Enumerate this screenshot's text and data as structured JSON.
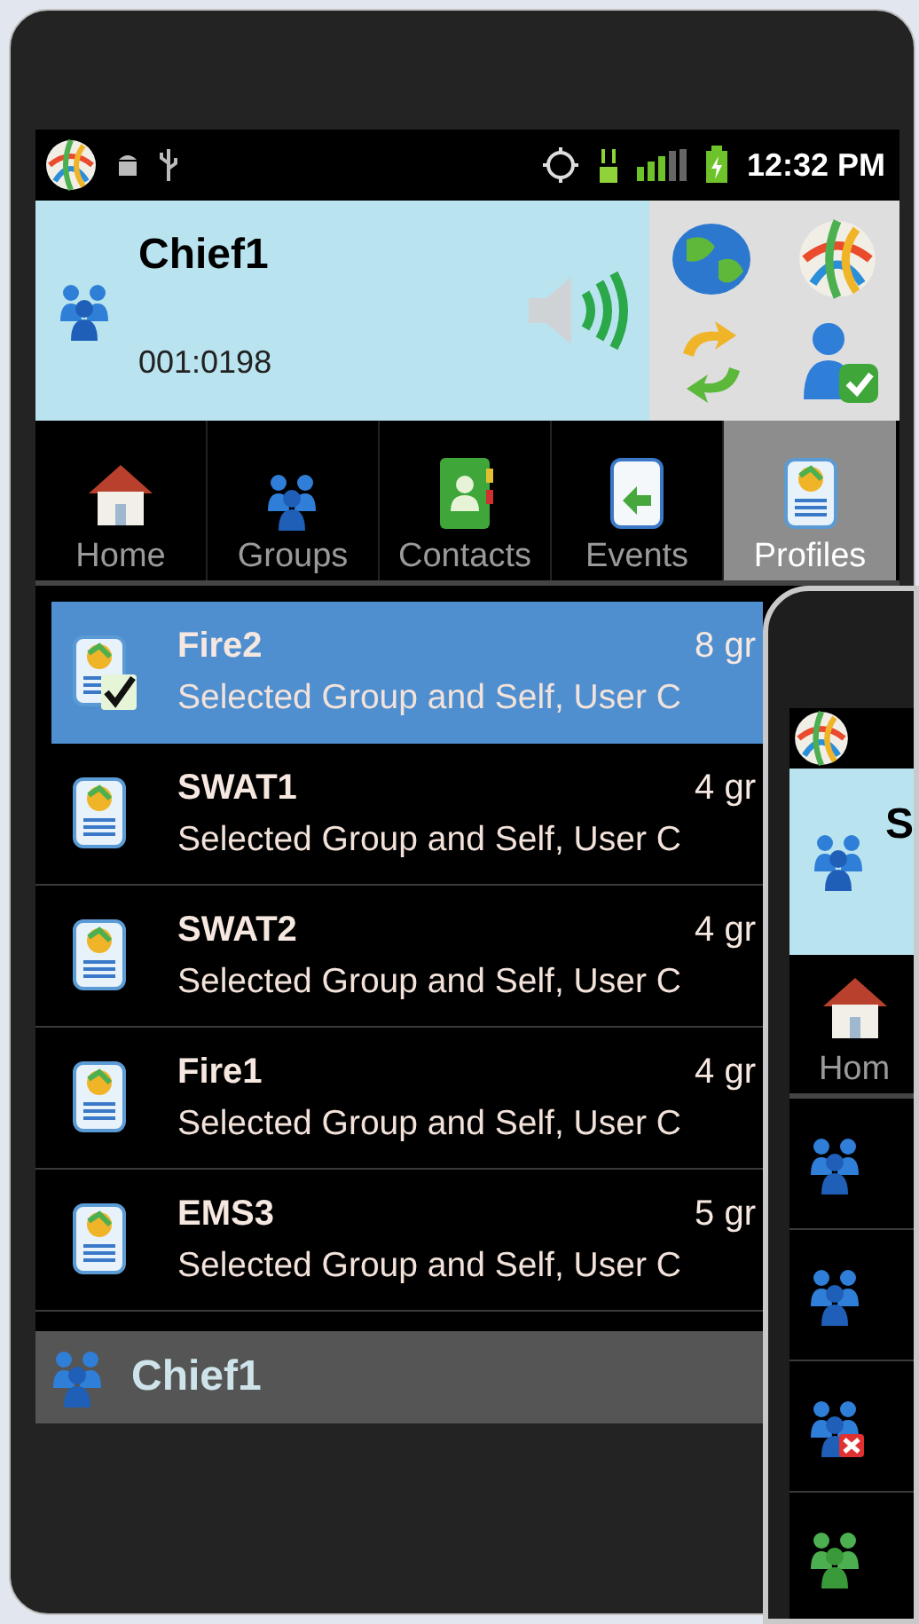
{
  "status_bar": {
    "time": "12:32 PM"
  },
  "header": {
    "title": "Chief1",
    "number": "001:0198"
  },
  "tabs": [
    {
      "label": "Home",
      "selected": false
    },
    {
      "label": "Groups",
      "selected": false
    },
    {
      "label": "Contacts",
      "selected": false
    },
    {
      "label": "Events",
      "selected": false
    },
    {
      "label": "Profiles",
      "selected": true
    }
  ],
  "profiles": [
    {
      "title": "Fire2",
      "count": "8 gr",
      "description": "Selected Group and Self, User C",
      "selected": true
    },
    {
      "title": "SWAT1",
      "count": "4 gr",
      "description": "Selected Group and Self, User C",
      "selected": false
    },
    {
      "title": "SWAT2",
      "count": "4 gr",
      "description": "Selected Group and Self, User C",
      "selected": false
    },
    {
      "title": "Fire1",
      "count": "4 gr",
      "description": "Selected Group and Self, User C",
      "selected": false
    },
    {
      "title": "EMS3",
      "count": "5 gr",
      "description": "Selected Group and Self, User C",
      "selected": false
    }
  ],
  "footer": {
    "label": "Chief1"
  },
  "second_phone": {
    "header_title": "S",
    "tab_label": "Hom",
    "rows": [
      {
        "kind": "group"
      },
      {
        "kind": "group"
      },
      {
        "kind": "group-blocked"
      },
      {
        "kind": "group-green"
      }
    ]
  }
}
